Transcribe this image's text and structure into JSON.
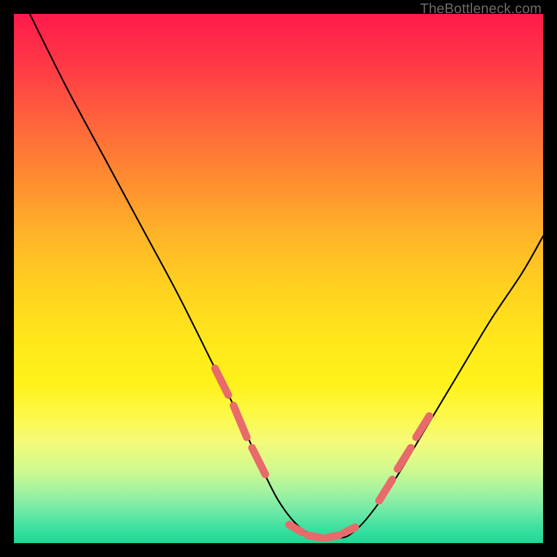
{
  "watermark": "TheBottleneck.com",
  "colors": {
    "background": "#000000",
    "curve": "#000000",
    "marker": "#e86a6a",
    "gradient_top": "#ff1a4b",
    "gradient_bottom": "#1cd996"
  },
  "chart_data": {
    "type": "line",
    "title": "",
    "xlabel": "",
    "ylabel": "",
    "xlim": [
      0,
      100
    ],
    "ylim": [
      0,
      100
    ],
    "grid": false,
    "legend": false,
    "notes": "Curve drawn in a 0–100 × 0–100 coordinate space; y=0 is the bottom (green), y=100 is the top (red). Values estimated from pixel positions; no axis ticks shown in the image.",
    "series": [
      {
        "name": "bottleneck-curve",
        "x": [
          3,
          10,
          17,
          24,
          31,
          38,
          42,
          46,
          50,
          54,
          58,
          62,
          64,
          67,
          72,
          78,
          84,
          90,
          96,
          100
        ],
        "y": [
          100,
          86,
          73,
          60,
          47,
          33,
          25,
          16,
          8,
          3,
          1,
          1,
          2,
          5,
          12,
          22,
          32,
          42,
          51,
          58
        ]
      }
    ],
    "markers": [
      {
        "name": "left-cluster",
        "segments": [
          {
            "x": [
              38,
              40.5
            ],
            "y": [
              33,
              28
            ]
          },
          {
            "x": [
              41.5,
              44
            ],
            "y": [
              26,
              20
            ]
          },
          {
            "x": [
              45,
              47.5
            ],
            "y": [
              18,
              13
            ]
          }
        ]
      },
      {
        "name": "bottom-cluster",
        "segments": [
          {
            "x": [
              52,
              54.5
            ],
            "y": [
              3.5,
              2
            ]
          },
          {
            "x": [
              55.5,
              58
            ],
            "y": [
              1.5,
              1
            ]
          },
          {
            "x": [
              59,
              61.5
            ],
            "y": [
              1,
              1.5
            ]
          },
          {
            "x": [
              62.5,
              64.5
            ],
            "y": [
              2,
              3
            ]
          }
        ]
      },
      {
        "name": "right-cluster",
        "segments": [
          {
            "x": [
              69,
              71.5
            ],
            "y": [
              8,
              12
            ]
          },
          {
            "x": [
              72.5,
              75
            ],
            "y": [
              14,
              18
            ]
          },
          {
            "x": [
              76,
              78.5
            ],
            "y": [
              20,
              24
            ]
          }
        ]
      }
    ]
  }
}
